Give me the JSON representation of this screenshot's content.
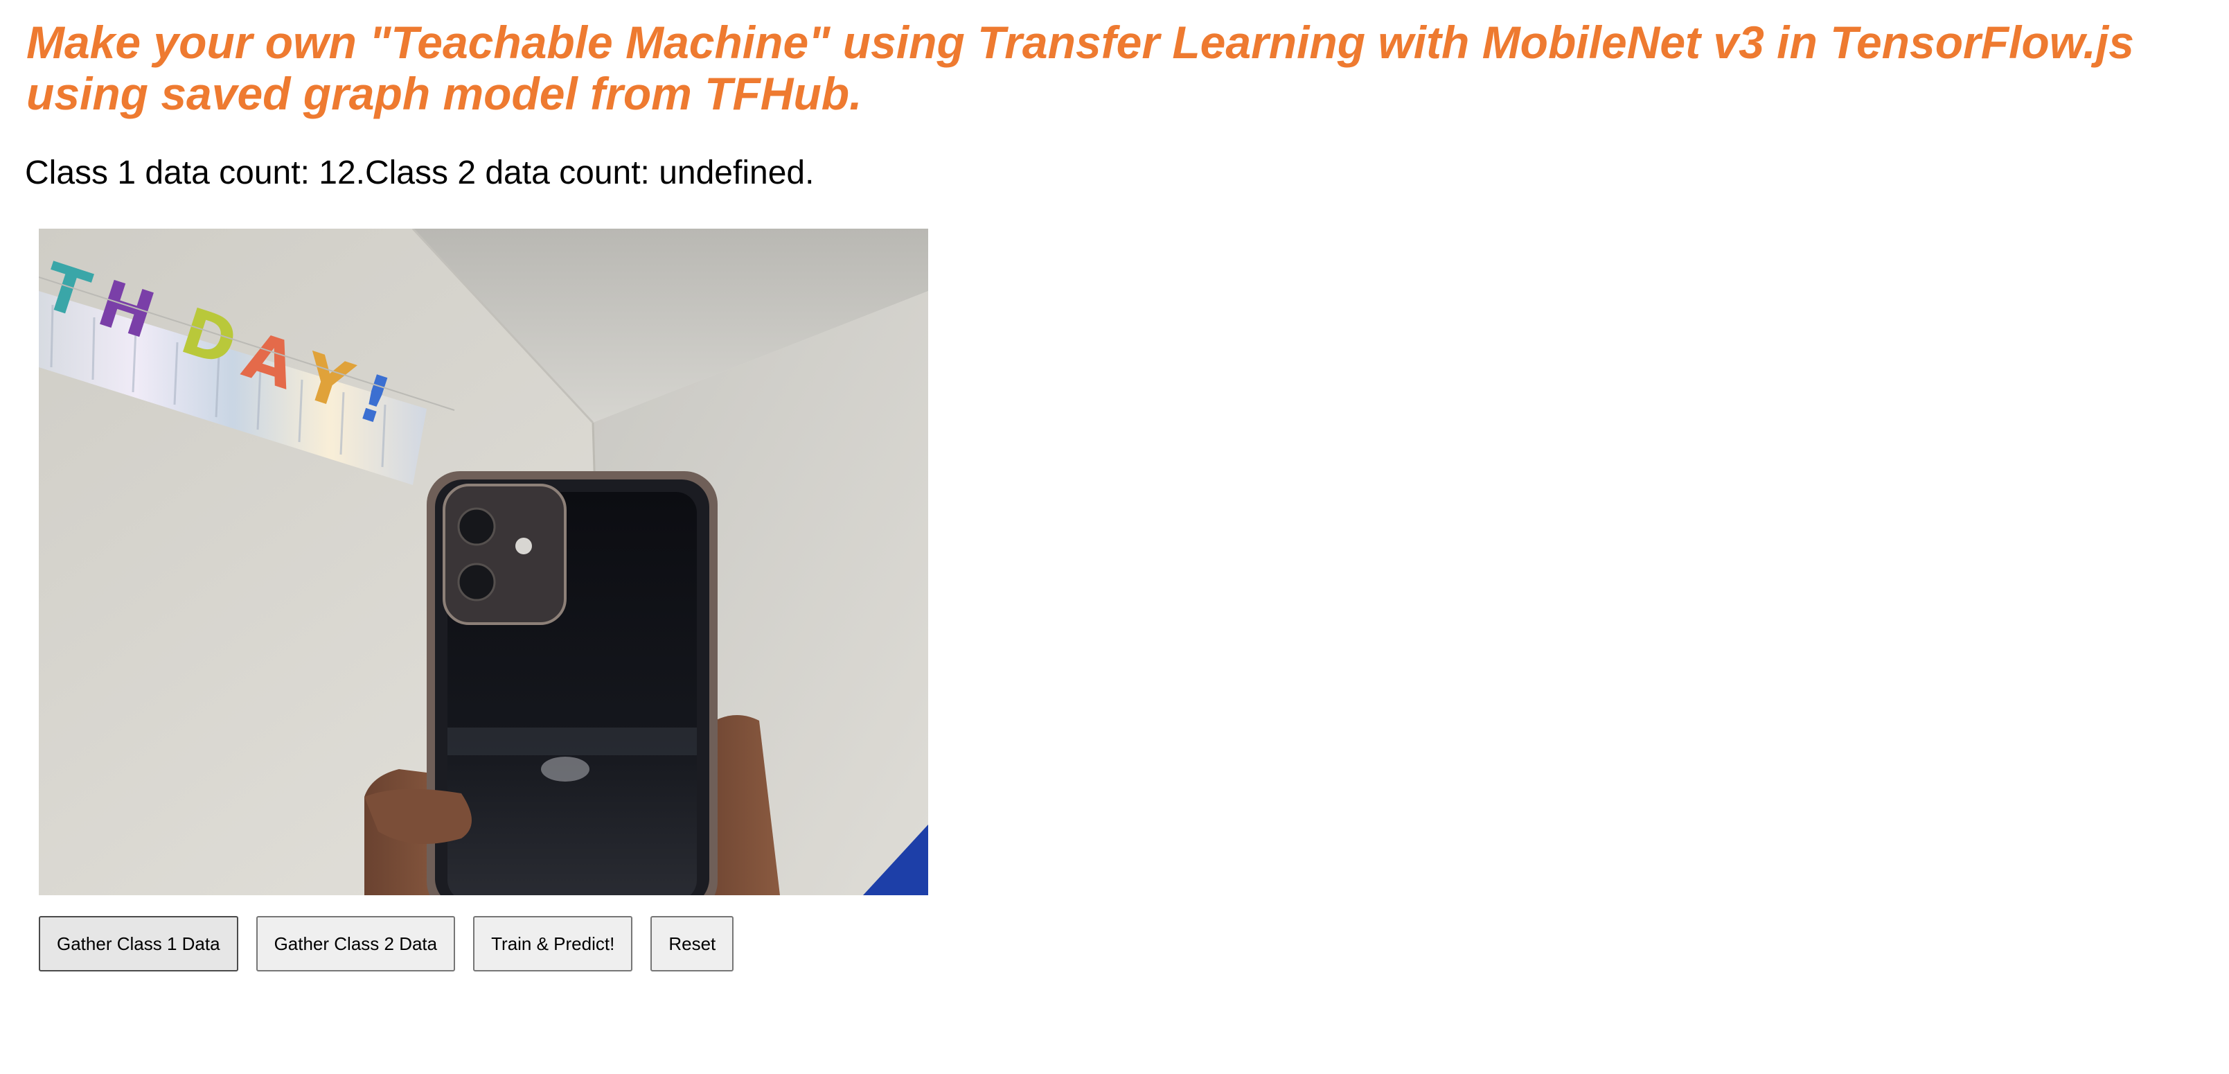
{
  "page": {
    "title": "Make your own \"Teachable Machine\" using Transfer Learning with MobileNet v3 in TensorFlow.js using saved graph model from TFHub.",
    "status": "Class 1 data count: 12.Class 2 data count: undefined."
  },
  "webcam": {
    "banner_text": "THDAY!"
  },
  "buttons": {
    "gather_class_1": "Gather Class 1 Data",
    "gather_class_2": "Gather Class 2 Data",
    "train_predict": "Train & Predict!",
    "reset": "Reset"
  },
  "colors": {
    "title": "#ee7a30"
  }
}
